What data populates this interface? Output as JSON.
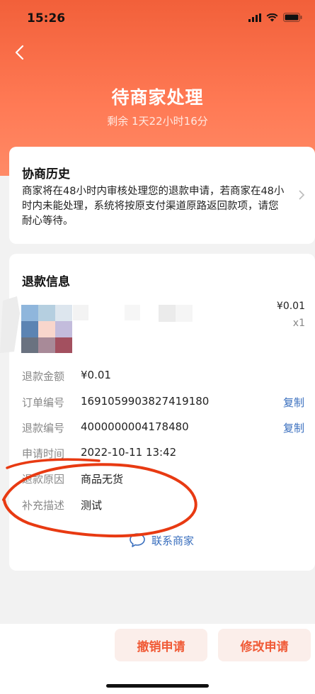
{
  "status_bar": {
    "time": "15:26"
  },
  "header": {
    "title": "待商家处理",
    "subtitle": "剩余 1天22小时16分"
  },
  "negotiation": {
    "title": "协商历史",
    "description": "商家将在48小时内审核处理您的退款申请，若商家在48小时内未能处理，系统将按原支付渠道原路返回款项，请您耐心等待。"
  },
  "refund_info": {
    "title": "退款信息",
    "product": {
      "price": "¥0.01",
      "quantity": "x1"
    },
    "rows": [
      {
        "label": "退款金额",
        "value": "¥0.01"
      },
      {
        "label": "订单编号",
        "value": "1691059903827419180",
        "action": "复制"
      },
      {
        "label": "退款编号",
        "value": "4000000004178480",
        "action": "复制"
      },
      {
        "label": "申请时间",
        "value": "2022-10-11 13:42"
      },
      {
        "label": "退款原因",
        "value": "商品无货"
      },
      {
        "label": "补充描述",
        "value": "测试"
      }
    ],
    "contact_label": "联系商家"
  },
  "actions": {
    "cancel_label": "撤销申请",
    "modify_label": "修改申请"
  },
  "colors": {
    "accent": "#f05a36",
    "link": "#3a6fbe",
    "header_gradient_top": "#f2603a",
    "annotation": "#e83a12"
  },
  "icons": [
    "back-icon",
    "chevron-right-icon",
    "chat-bubble-icon",
    "signal-icon",
    "wifi-icon",
    "battery-icon"
  ]
}
